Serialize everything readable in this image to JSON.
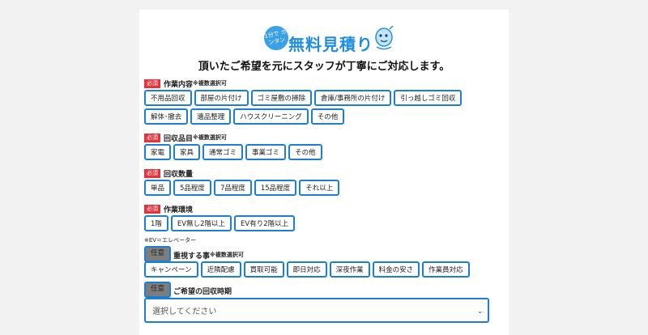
{
  "hero": {
    "badge_text": "1分で カンタン",
    "title": "無料見積り",
    "subtitle": "頂いたご希望を元にスタッフが丁寧にご対応します。"
  },
  "tags": {
    "required": "必須",
    "optional": "任意"
  },
  "sections": [
    {
      "label": "作業内容",
      "note": "※複数選択可",
      "required": true,
      "options": [
        "不用品回収",
        "部屋の片付け",
        "ゴミ屋敷の掃除",
        "倉庫/事務所の片付け",
        "引っ越しゴミ回収",
        "解体･撤去",
        "遺品整理",
        "ハウスクリーニング",
        "その他"
      ]
    },
    {
      "label": "回収品目",
      "note": "※複数選択可",
      "required": true,
      "options": [
        "家電",
        "家具",
        "通常ゴミ",
        "事業ゴミ",
        "その他"
      ]
    },
    {
      "label": "回収数量",
      "note": "",
      "required": true,
      "options": [
        "単品",
        "5品程度",
        "7品程度",
        "15品程度",
        "それ以上"
      ]
    },
    {
      "label": "作業環境",
      "note": "",
      "required": true,
      "options": [
        "1階",
        "EV無し2階以上",
        "EV有り2階以上"
      ]
    },
    {
      "label": "重視する事",
      "note": "※複数選択可",
      "required": false,
      "options": [
        "キャンペーン",
        "近隣配慮",
        "買取可能",
        "即日対応",
        "深夜作業",
        "料金の安さ",
        "作業員対応"
      ]
    }
  ],
  "ev_note": "※EV＝エレベーター",
  "timing": {
    "label": "ご希望の回収時期",
    "selected": "選択してください"
  },
  "colors": {
    "accent": "#1c7ed6",
    "required": "#e0353f",
    "optional": "#7d7d7d"
  },
  "icons": {
    "dropdown": "chevron-down-icon",
    "mascot": "mascot-icon"
  }
}
